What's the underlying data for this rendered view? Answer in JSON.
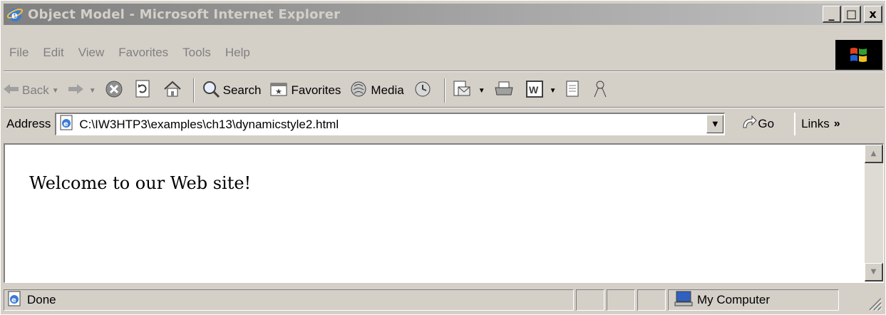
{
  "window": {
    "title": "Object Model - Microsoft Internet Explorer",
    "minimize": "_",
    "maximize": "□",
    "close": "x"
  },
  "menu": [
    "File",
    "Edit",
    "View",
    "Favorites",
    "Tools",
    "Help"
  ],
  "toolbar": {
    "back": "Back",
    "search": "Search",
    "favorites": "Favorites",
    "media": "Media"
  },
  "address": {
    "label": "Address",
    "url": "C:\\IW3HTP3\\examples\\ch13\\dynamicstyle2.html",
    "go": "Go",
    "links": "Links",
    "links_chevron": "»"
  },
  "page": {
    "text": "Welcome to our Web site!"
  },
  "status": {
    "text": "Done",
    "zone": "My Computer"
  },
  "colors": {
    "titlebar_inactive": "#808080",
    "chrome": "#d4d0c8"
  }
}
